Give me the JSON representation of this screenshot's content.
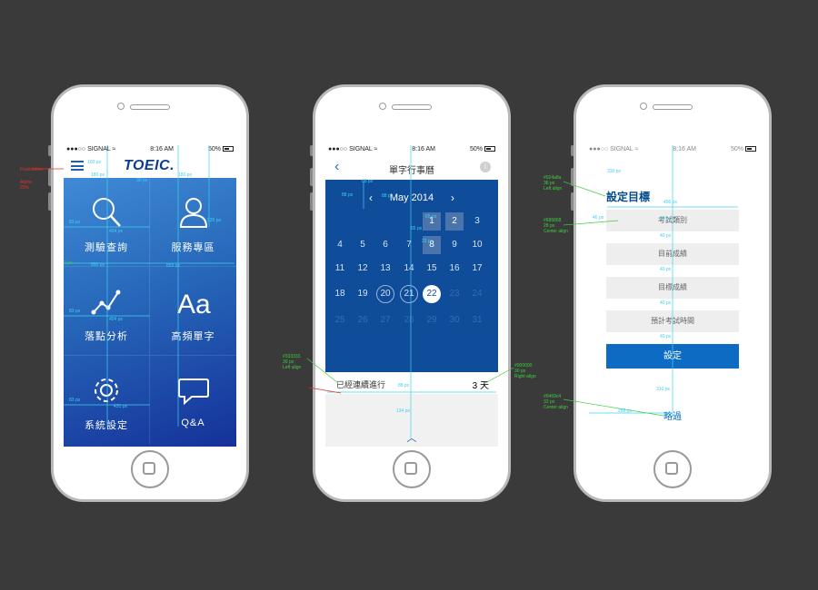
{
  "status_bar": {
    "signal": "SIGNAL",
    "time": "8:16 AM",
    "battery": "50%"
  },
  "screen1": {
    "logo": "TOEIC.",
    "tiles": [
      {
        "label": "測驗查詢",
        "icon": "search-icon"
      },
      {
        "label": "服務專區",
        "icon": "user-icon"
      },
      {
        "label": "落點分析",
        "icon": "trend-chart-icon"
      },
      {
        "label": "高頻單字",
        "icon": "text-aa-icon"
      },
      {
        "label": "系統設定",
        "icon": "gear-icon"
      },
      {
        "label": "Q&A",
        "icon": "chat-bubble-icon"
      }
    ],
    "annotations": {
      "side_label": "Foundation",
      "side_sub": "Alpha\n20%",
      "m1": "100 px",
      "m2": "180 px",
      "m3": "180 px",
      "m4": "30 px",
      "m5": "520 px",
      "m6": "83 px",
      "m7": "404 px",
      "m8": "850 px",
      "m9": "859 px",
      "m10": "83 px",
      "m11": "404 px",
      "m12": "83 px",
      "m13": "431 px",
      "m14": "2 px"
    }
  },
  "screen2": {
    "title": "單字行事曆",
    "month": "May 2014",
    "weeks": [
      [
        "",
        "",
        "",
        "",
        "1",
        "2",
        "3"
      ],
      [
        "4",
        "5",
        "6",
        "7",
        "8",
        "9",
        "10"
      ],
      [
        "11",
        "12",
        "13",
        "14",
        "15",
        "16",
        "17"
      ],
      [
        "18",
        "19",
        "20",
        "21",
        "22",
        "23",
        "24"
      ],
      [
        "25",
        "26",
        "27",
        "28",
        "29",
        "30",
        "31"
      ]
    ],
    "streak_label": "已經連續進行",
    "streak_value": "3 天",
    "annotations": {
      "c1": "#333333\n30 px\nLeft align",
      "c2": "#000000\n30 px\nRight align",
      "m1": "88 px",
      "m2": "88 px",
      "m3": "65 px",
      "m4": "65 px",
      "m5": "88 px",
      "m6": "134 px",
      "m7": "88 px",
      "m8": "22 px"
    }
  },
  "screen3": {
    "title": "設定目標",
    "fields": [
      "考試類別",
      "目前成績",
      "目標成績",
      "預計考試時間"
    ],
    "submit": "設定",
    "skip": "略過",
    "annotations": {
      "c1": "#024a8a\n36 px\nLeft align",
      "c2": "#686868\n28 px\nCenter align",
      "c3": "#0469c4\n32 px\nCenter align",
      "m1": "330 px",
      "m2": "406 px",
      "m3": "40 px",
      "m4": "40 px",
      "m5": "40 px",
      "m6": "40 px",
      "m7": "40 px",
      "m8": "310 px",
      "m9": "288 px",
      "m10": "46 px"
    }
  },
  "colors": {
    "background": "#3a3a3a",
    "primary_blue": "#0e6bc4",
    "calendar_blue": "#0f4d9b",
    "title_blue": "#024a8a"
  }
}
